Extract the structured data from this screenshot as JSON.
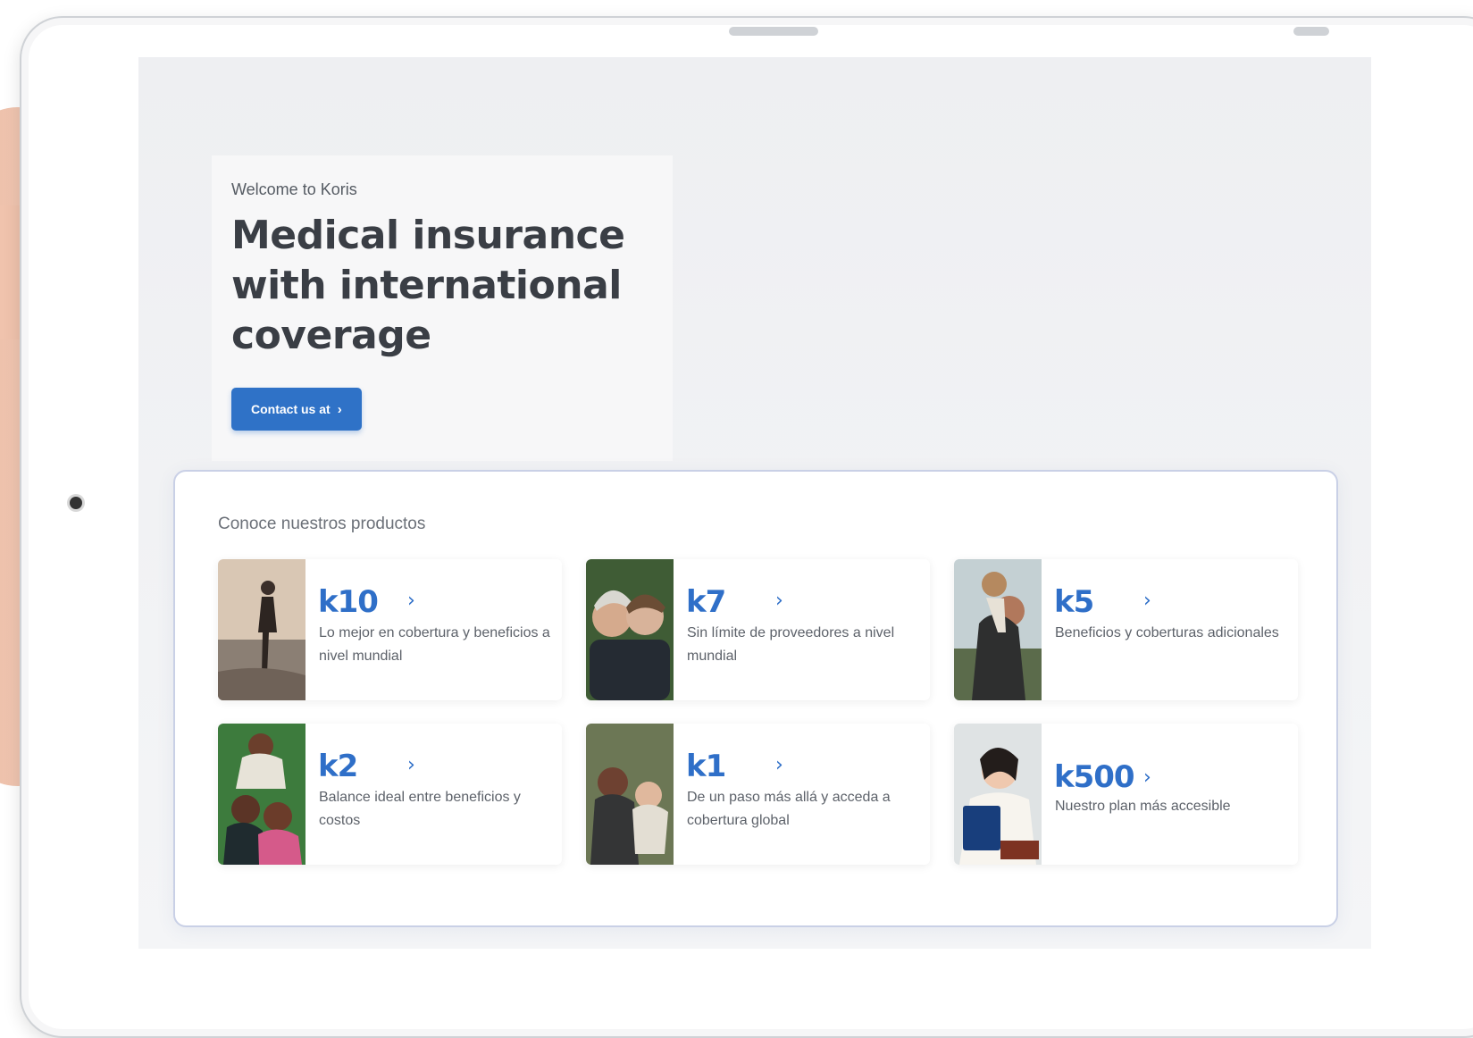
{
  "hero": {
    "eyebrow": "Welcome to Koris",
    "headline": "Medical insurance with international coverage",
    "cta_label": "Contact us at"
  },
  "products": {
    "title": "Conoce nuestros productos",
    "items": [
      {
        "name": "k10",
        "description": "Lo mejor en cobertura y beneficios a nivel mundial"
      },
      {
        "name": "k7",
        "description": "Sin límite de proveedores a nivel mundial"
      },
      {
        "name": "k5",
        "description": "Beneficios y coberturas adicionales"
      },
      {
        "name": "k2",
        "description": "Balance ideal entre beneficios y costos"
      },
      {
        "name": "k1",
        "description": "De un paso más allá y acceda a cobertura global"
      },
      {
        "name": "k500",
        "description": "Nuestro plan más accesible"
      }
    ]
  },
  "icons": {
    "cta": "chevron-right-icon",
    "product": "chevron-right-icon"
  },
  "colors": {
    "brand_blue": "#2f72c7",
    "brand_teal": "#17b39f",
    "text_dark": "#3a3e45"
  }
}
